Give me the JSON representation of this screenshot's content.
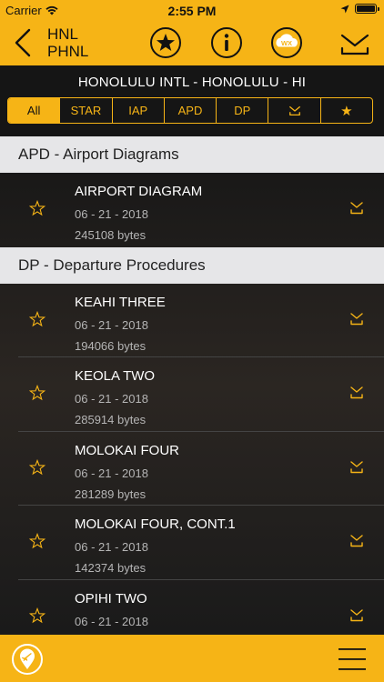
{
  "status_bar": {
    "carrier": "Carrier",
    "time": "2:55 PM"
  },
  "nav": {
    "code_faa": "HNL",
    "code_icao": "PHNL"
  },
  "banner": {
    "airport_title": "HONOLULU INTL - HONOLULU - HI"
  },
  "filters": [
    {
      "label": "All",
      "active": true
    },
    {
      "label": "STAR"
    },
    {
      "label": "IAP"
    },
    {
      "label": "APD"
    },
    {
      "label": "DP"
    },
    {
      "icon": "download-icon"
    },
    {
      "label": "★"
    }
  ],
  "sections": [
    {
      "header": "APD - Airport Diagrams",
      "items": [
        {
          "name": "AIRPORT DIAGRAM",
          "date": "06 - 21 - 2018",
          "size": "245108 bytes"
        }
      ]
    },
    {
      "header": "DP - Departure Procedures",
      "items": [
        {
          "name": "KEAHI THREE",
          "date": "06 - 21 - 2018",
          "size": "194066 bytes"
        },
        {
          "name": "KEOLA TWO",
          "date": "06 - 21 - 2018",
          "size": "285914 bytes"
        },
        {
          "name": "MOLOKAI FOUR",
          "date": "06 - 21 - 2018",
          "size": "281289 bytes"
        },
        {
          "name": "MOLOKAI FOUR, CONT.1",
          "date": "06 - 21 - 2018",
          "size": "142374 bytes"
        },
        {
          "name": "OPIHI TWO",
          "date": "06 - 21 - 2018",
          "size": ""
        }
      ]
    }
  ],
  "colors": {
    "accent": "#f6b416",
    "dark": "#151515",
    "section_bg": "#e6e6e8"
  },
  "nav_wx_label": "WX"
}
